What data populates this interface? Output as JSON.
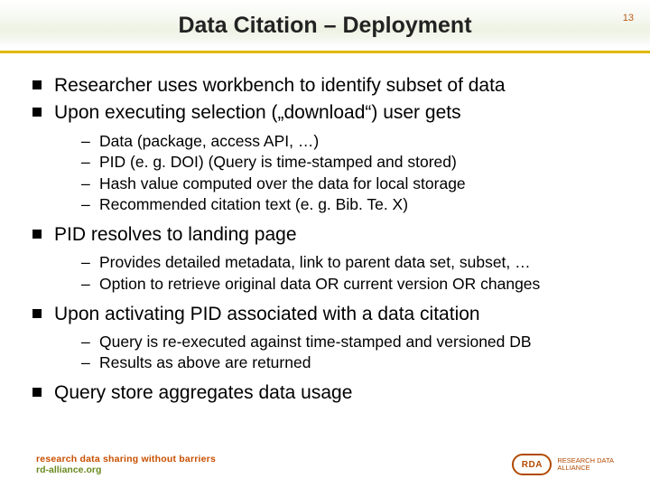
{
  "page_number": "13",
  "title": "Data Citation – Deployment",
  "bullets": [
    {
      "text": "Researcher uses workbench to identify subset of data",
      "sub": []
    },
    {
      "text": "Upon executing selection („download“) user gets",
      "sub": [
        "Data (package, access API, …)",
        "PID (e. g. DOI)  (Query is time-stamped and stored)",
        "Hash value computed over the data for local storage",
        "Recommended citation text (e. g. Bib. Te. X)"
      ]
    },
    {
      "text": "PID resolves to landing page",
      "sub": [
        "Provides detailed metadata, link to parent data set, subset, …",
        "Option to retrieve original data OR current version OR changes"
      ]
    },
    {
      "text": "Upon activating PID associated with a data citation",
      "sub": [
        "Query is re-executed against time-stamped and versioned DB",
        "Results as above are returned"
      ]
    },
    {
      "text": "Query store aggregates data usage",
      "sub": []
    }
  ],
  "footer": {
    "left_line1": "research data sharing without barriers",
    "left_line2": "rd-alliance.org",
    "rda_badge": "RDA",
    "rda_text_line1": "RESEARCH DATA",
    "rda_text_line2": "ALLIANCE"
  }
}
